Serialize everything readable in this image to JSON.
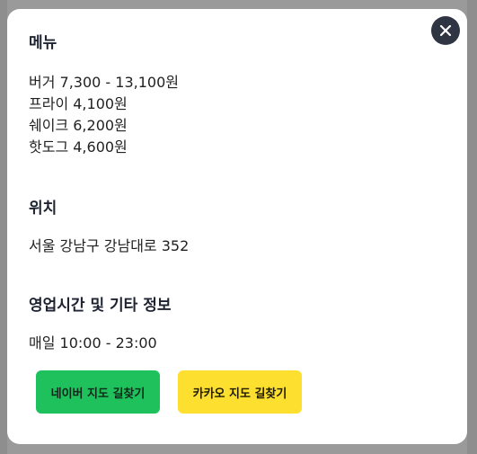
{
  "modal": {
    "close_label": "✕",
    "sections": {
      "menu": {
        "title": "메뉴",
        "items": [
          "버거 7,300 - 13,100원",
          "프라이 4,100원",
          "쉐이크 6,200원",
          "핫도그 4,600원"
        ]
      },
      "location": {
        "title": "위치",
        "address": "서울 강남구 강남대로 352"
      },
      "hours": {
        "title": "영업시간 및 기타 정보",
        "text": "매일 10:00 - 23:00"
      }
    },
    "buttons": {
      "naver": "네이버 지도 길찾기",
      "kakao": "카카오 지도 길찾기"
    }
  },
  "colors": {
    "naver_green": "#1ec15b",
    "kakao_yellow": "#fddf2f",
    "close_button": "#2f3542"
  }
}
